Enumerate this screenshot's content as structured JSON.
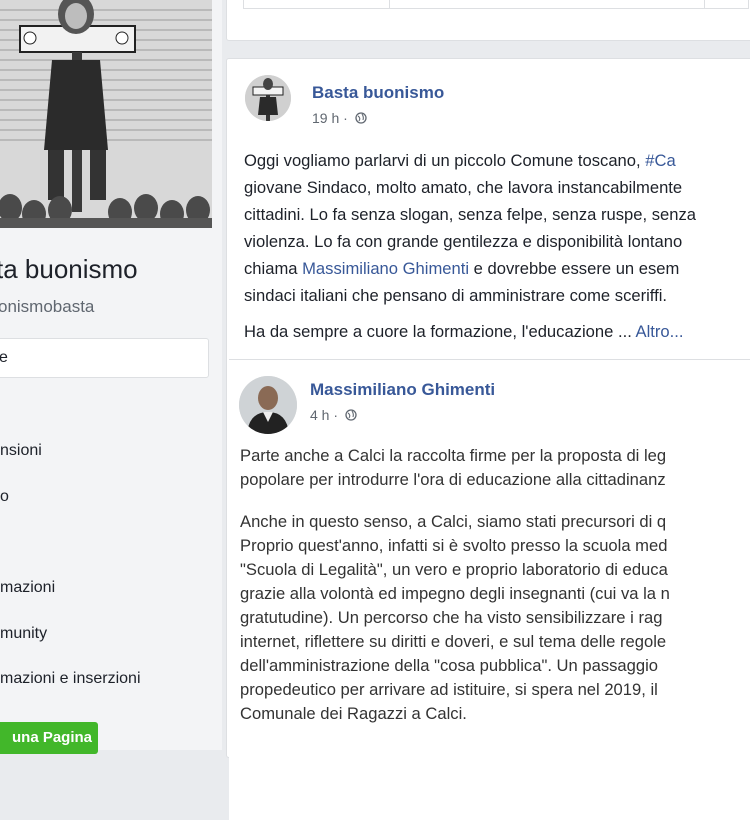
{
  "sidebar": {
    "page_name": "ta buonismo",
    "page_handle": "onismobasta",
    "home_label": "e",
    "nav_items": [
      {
        "label": "nsioni"
      },
      {
        "label": "o"
      },
      {
        "label": "mazioni"
      },
      {
        "label": "munity"
      },
      {
        "label": "mazioni e inserzioni"
      }
    ],
    "create_page_label": "una Pagina"
  },
  "post": {
    "author": "Basta buonismo",
    "time": "19 h",
    "dot": "·",
    "lines": [
      {
        "text": "Oggi vogliamo parlarvi di un piccolo Comune toscano, ",
        "link": "#Ca"
      },
      {
        "text": "giovane Sindaco, molto amato, che lavora instancabilmente"
      },
      {
        "text": "cittadini. Lo fa senza slogan, senza felpe, senza ruspe, senza"
      },
      {
        "text": "violenza. Lo fa con grande gentilezza e disponibilità lontano"
      },
      {
        "text": "chiama ",
        "link": "Massimiliano Ghimenti",
        "after": " e dovrebbe essere un esem"
      },
      {
        "text": "sindaci italiani che pensano di amministrare come sceriffi."
      }
    ],
    "last_line": "Ha da sempre a cuore la formazione, l'educazione ...",
    "more_label": "Altro...",
    "shared": {
      "author": "Massimiliano Ghimenti",
      "time": "4 h",
      "dot": "·",
      "paragraph1": [
        "Parte anche a Calci la raccolta firme per la proposta di leg",
        "popolare per introdurre l'ora di educazione alla cittadinanz"
      ],
      "paragraph2": [
        "Anche in questo senso, a Calci, siamo stati precursori di q",
        "Proprio quest'anno, infatti si è svolto presso la scuola med",
        "\"Scuola di Legalità\", un vero e proprio laboratorio di educa",
        "grazie alla volontà ed impegno degli insegnanti (cui va la n",
        "gratutudine). Un percorso che ha visto sensibilizzare i rag",
        "internet, riflettere su diritti e doveri, e sul tema delle regole",
        "dell'amministrazione della \"cosa pubblica\". Un passaggio",
        "propedeutico per arrivare ad istituire, si spera nel 2019, il",
        "Comunale dei Ragazzi a Calci."
      ]
    }
  },
  "colors": {
    "link": "#385898",
    "background": "#e9ebee",
    "button_green": "#42b72a"
  }
}
